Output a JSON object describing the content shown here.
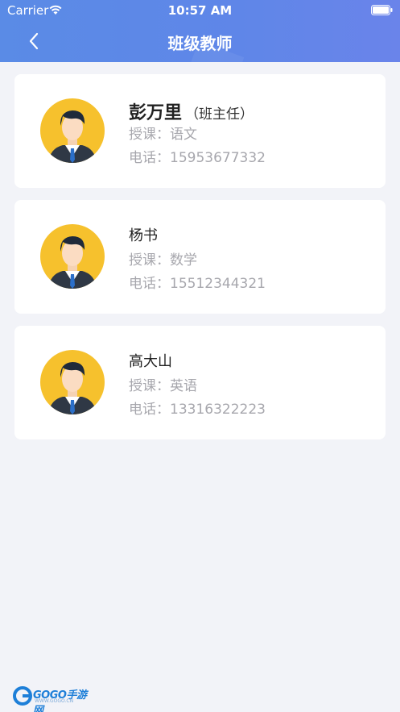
{
  "status_bar": {
    "carrier": "Carrier",
    "time": "10:57 AM"
  },
  "nav": {
    "title": "班级教师",
    "back_icon": "chevron-left-icon"
  },
  "teachers": [
    {
      "name": "彭万里",
      "role": "（班主任）",
      "subject_label": "授课：",
      "subject": "语文",
      "phone_label": "电话：",
      "phone": "15953677332"
    },
    {
      "name": "杨书",
      "role": "",
      "subject_label": "授课：",
      "subject": "数学",
      "phone_label": "电话：",
      "phone": "15512344321"
    },
    {
      "name": "高大山",
      "role": "",
      "subject_label": "授课：",
      "subject": "英语",
      "phone_label": "电话：",
      "phone": "13316322223"
    }
  ],
  "watermark": {
    "brand": "GOGO手游网",
    "url": "WWW.GOGO.CN"
  },
  "colors": {
    "header_start": "#5a8be6",
    "header_end": "#6a84ea",
    "background": "#f2f3f8",
    "avatar_bg": "#f6c12d",
    "secondary_text": "#a7a7ad"
  }
}
